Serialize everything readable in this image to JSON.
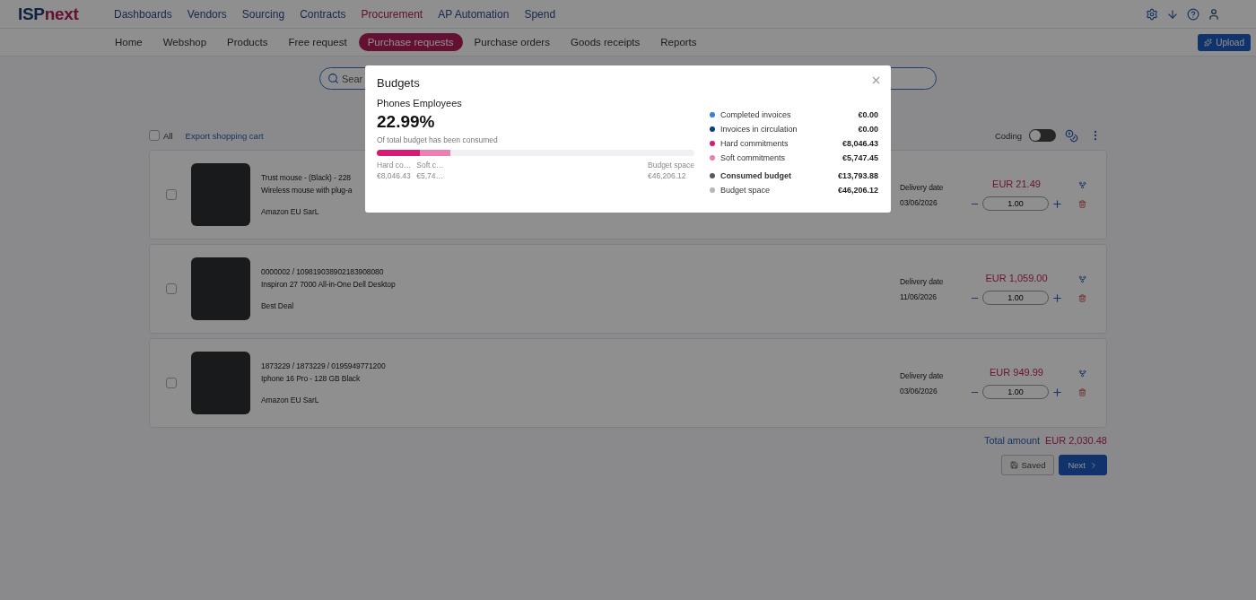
{
  "logo": {
    "part_1": "ISP",
    "part_2": "next"
  },
  "main_nav": [
    {
      "label": "Dashboards",
      "selected": false
    },
    {
      "label": "Vendors",
      "selected": false
    },
    {
      "label": "Sourcing",
      "selected": false
    },
    {
      "label": "Contracts",
      "selected": false
    },
    {
      "label": "Procurement",
      "selected": true
    },
    {
      "label": "AP Automation",
      "selected": false
    },
    {
      "label": "Spend",
      "selected": false
    }
  ],
  "sub_nav": [
    {
      "label": "Home",
      "selected": false
    },
    {
      "label": "Webshop",
      "selected": false
    },
    {
      "label": "Products",
      "selected": false
    },
    {
      "label": "Free request",
      "selected": false
    },
    {
      "label": "Purchase requests",
      "selected": true
    },
    {
      "label": "Purchase orders",
      "selected": false
    },
    {
      "label": "Goods receipts",
      "selected": false
    },
    {
      "label": "Reports",
      "selected": false
    }
  ],
  "upload_button": "Upload",
  "search": {
    "placeholder": "Sear"
  },
  "cart": {
    "select_all": {
      "label": "All",
      "checked": false
    },
    "export_link": "Export shopping cart",
    "coding": {
      "label": "Coding",
      "on": false
    }
  },
  "items": [
    {
      "checked": false,
      "id_line": "Trust mouse - (Black) - 228",
      "description": "Wireless mouse with plug-a",
      "vendor": "Amazon EU SarL",
      "delivery_label": "Delivery date",
      "delivery_date": "03/06/2026",
      "price": "EUR 21.49",
      "quantity": "1.00"
    },
    {
      "checked": false,
      "id_line": "0000002 / 109819038902183908080",
      "description": "Inspiron 27 7000 All-in-One Dell Desktop",
      "vendor": "Best Deal",
      "delivery_label": "Delivery date",
      "delivery_date": "11/06/2026",
      "price": "EUR 1,059.00",
      "quantity": "1.00"
    },
    {
      "checked": false,
      "id_line": "1873229 / 1873229 / 0195949771200",
      "description": "Iphone 16 Pro - 128 GB Black",
      "vendor": "Amazon EU SarL",
      "delivery_label": "Delivery date",
      "delivery_date": "03/06/2026",
      "price": "EUR 949.99",
      "quantity": "1.00"
    }
  ],
  "total": {
    "label": "Total amount",
    "amount": "EUR 2,030.48"
  },
  "actions": [
    {
      "label": "Saved",
      "kind": "save",
      "disabled": true
    },
    {
      "label": "Next",
      "kind": "next",
      "disabled": false
    }
  ],
  "modal": {
    "title": "Budgets",
    "budget_name": "Phones Employees",
    "percentage": "22.99%",
    "caption": "Of total budget has been consumed",
    "bar": [
      {
        "label": "Hard co…",
        "value": "€8,046.43",
        "level": 0.136,
        "color": "#d81b72"
      },
      {
        "label": "Soft c…",
        "value": "€5,74…",
        "level": 0.096,
        "color": "#ec7fb0"
      }
    ],
    "bar_end": {
      "label": "Budget space",
      "value": "€46,206.12"
    },
    "legend": [
      {
        "label": "Completed invoices",
        "value": "€0.00",
        "color": "#3b7ddd",
        "emphasis": false
      },
      {
        "label": "Invoices in circulation",
        "value": "€0.00",
        "color": "#0d3b82",
        "emphasis": false
      },
      {
        "label": "Hard commitments",
        "value": "€8,046.43",
        "color": "#d81b72",
        "emphasis": false
      },
      {
        "label": "Soft commitments",
        "value": "€5,747.45",
        "color": "#ec7fb0",
        "emphasis": false
      }
    ],
    "summary": [
      {
        "label": "Consumed budget",
        "value": "€13,793.88",
        "color": "#555a62",
        "emphasis": true
      },
      {
        "label": "Budget space",
        "value": "€46,206.12",
        "color": "#b4b7bc",
        "emphasis": false
      }
    ]
  }
}
